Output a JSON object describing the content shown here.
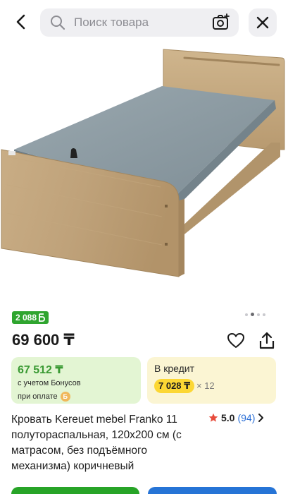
{
  "search": {
    "placeholder": "Поиск товара"
  },
  "gallery": {
    "dots_total": 4,
    "active_dot": 2
  },
  "bonus_badge": {
    "text": "2 088",
    "icon": "bonus-b-icon"
  },
  "price": {
    "text": "69 600 ₸"
  },
  "bonus_card": {
    "amount": "67 512 ₸",
    "line1": "с учетом Бонусов",
    "line2": "при оплате",
    "coin_glyph": "Б"
  },
  "credit_card": {
    "title": "В кредит",
    "monthly": "7 028 ₸",
    "multiplier": "× 12"
  },
  "product": {
    "title": "Кровать Kereuet mebel Franko 11 полуторaспальная, 120х200 см (с матрасом, без подъёмного механизма) коричневый"
  },
  "rating": {
    "score": "5.0",
    "count": "(94)",
    "star_color": "#e74c3c"
  },
  "colors": {
    "green": "#27a427",
    "blue": "#2674d6",
    "accent_yellow": "#fcd734"
  }
}
